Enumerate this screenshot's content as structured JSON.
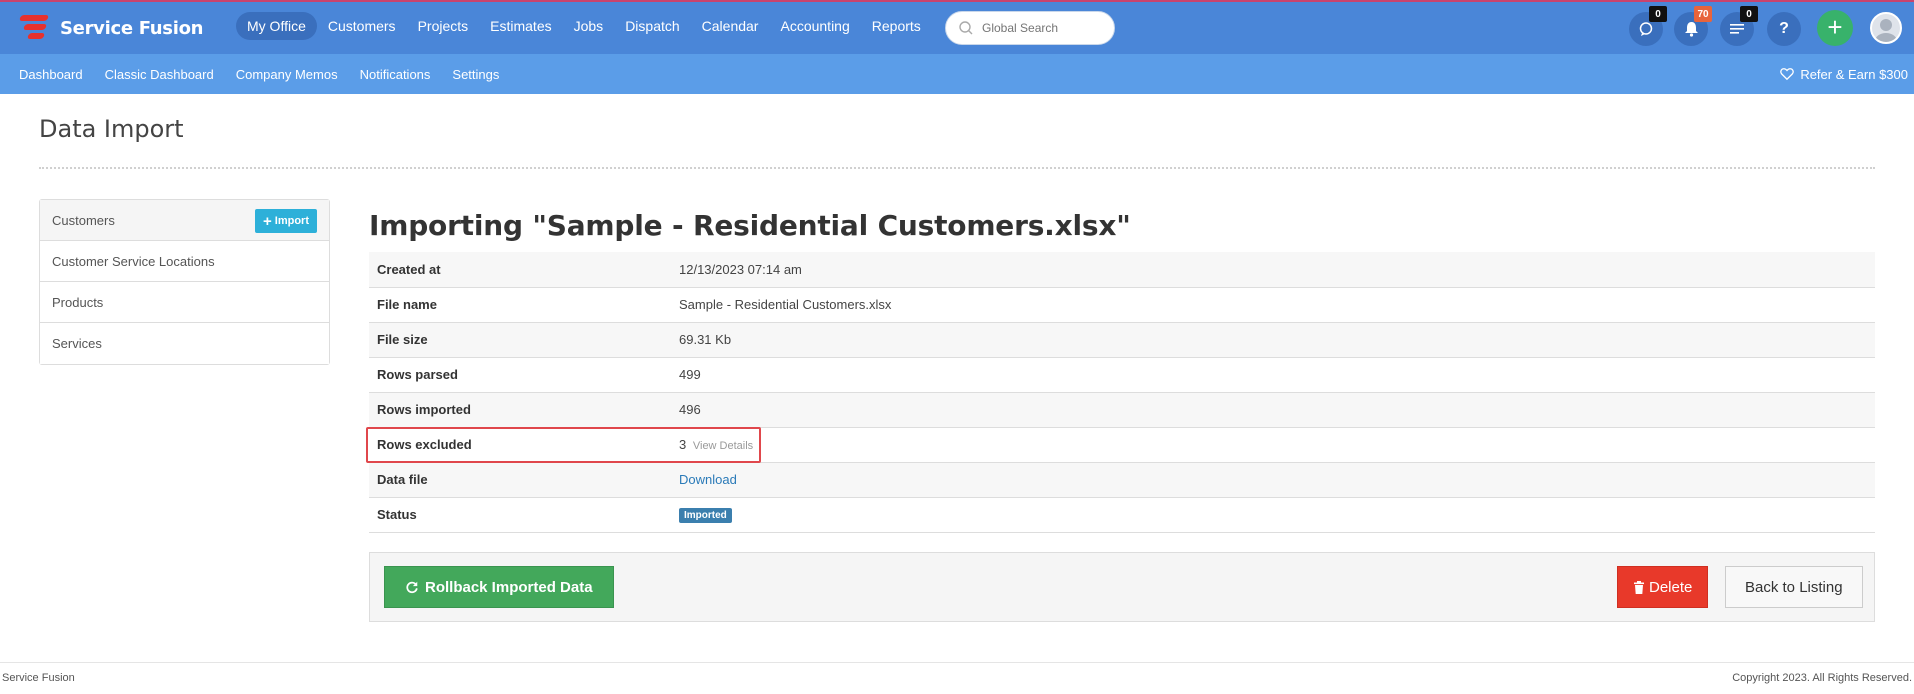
{
  "brand": {
    "name": "Service Fusion"
  },
  "nav": {
    "items": [
      {
        "label": "My Office",
        "active": true
      },
      {
        "label": "Customers"
      },
      {
        "label": "Projects"
      },
      {
        "label": "Estimates"
      },
      {
        "label": "Jobs"
      },
      {
        "label": "Dispatch"
      },
      {
        "label": "Calendar"
      },
      {
        "label": "Accounting"
      },
      {
        "label": "Reports"
      }
    ],
    "search_placeholder": "Global Search",
    "chat_count": "0",
    "notification_count": "70",
    "tasks_count": "0",
    "help_label": "?",
    "add_label": "+"
  },
  "subnav": {
    "items": [
      "Dashboard",
      "Classic Dashboard",
      "Company Memos",
      "Notifications",
      "Settings"
    ],
    "refer_label": "Refer & Earn $300"
  },
  "page": {
    "title": "Data Import"
  },
  "sidebar": {
    "items": [
      {
        "label": "Customers",
        "active": true
      },
      {
        "label": "Customer Service Locations"
      },
      {
        "label": "Products"
      },
      {
        "label": "Services"
      }
    ],
    "import_label": "Import"
  },
  "main": {
    "title": "Importing \"Sample - Residential Customers.xlsx\"",
    "rows": [
      {
        "label": "Created at",
        "value": "12/13/2023 07:14 am"
      },
      {
        "label": "File name",
        "value": "Sample - Residential Customers.xlsx"
      },
      {
        "label": "File size",
        "value": "69.31 Kb"
      },
      {
        "label": "Rows parsed",
        "value": "499"
      },
      {
        "label": "Rows imported",
        "value": "496"
      },
      {
        "label": "Rows excluded",
        "value": "3",
        "extra": "View Details"
      },
      {
        "label": "Data file",
        "value": "Download"
      },
      {
        "label": "Status",
        "value": "Imported"
      }
    ],
    "rollback_label": "Rollback Imported Data",
    "delete_label": "Delete",
    "back_label": "Back to Listing"
  },
  "footer": {
    "left": "Service Fusion",
    "right": "Copyright 2023. All Rights Reserved."
  },
  "colors": {
    "topbar": "#4a86d8",
    "subbar": "#5b9de8",
    "accent_green": "#43a85b",
    "danger_red": "#e8392a",
    "info_blue": "#2db0d9"
  }
}
